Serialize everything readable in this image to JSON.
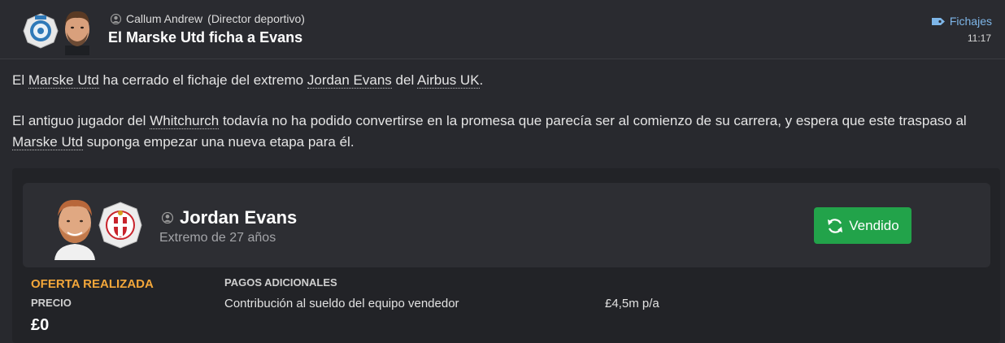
{
  "header": {
    "author": "Callum Andrew",
    "author_role": "(Director deportivo)",
    "headline": "El Marske Utd ficha a Evans",
    "category": "Fichajes",
    "time": "11:17"
  },
  "body": {
    "p1": [
      "El ",
      "Marske Utd",
      " ha cerrado el fichaje del extremo ",
      "Jordan Evans",
      " del ",
      "Airbus UK",
      "."
    ],
    "p2": [
      "El antiguo jugador del ",
      "Whitchurch",
      " todavía no ha podido convertirse en la promesa que parecía ser al comienzo de su carrera, y espera que este traspaso al ",
      "Marske Utd",
      " suponga empezar una nueva etapa para él."
    ]
  },
  "player": {
    "name": "Jordan Evans",
    "description": "Extremo de 27 años",
    "status": "Vendido"
  },
  "offer": {
    "title": "OFERTA REALIZADA",
    "price_label": "PRECIO",
    "price_value": "£0",
    "extras_title": "PAGOS ADICIONALES",
    "extras": [
      {
        "label": "Contribución al sueldo del equipo vendedor",
        "value": "£4,5m p/a"
      }
    ]
  },
  "colors": {
    "accent_link": "#7eb6e8",
    "offer_title": "#f4a73a",
    "status_button": "#22a34a"
  }
}
